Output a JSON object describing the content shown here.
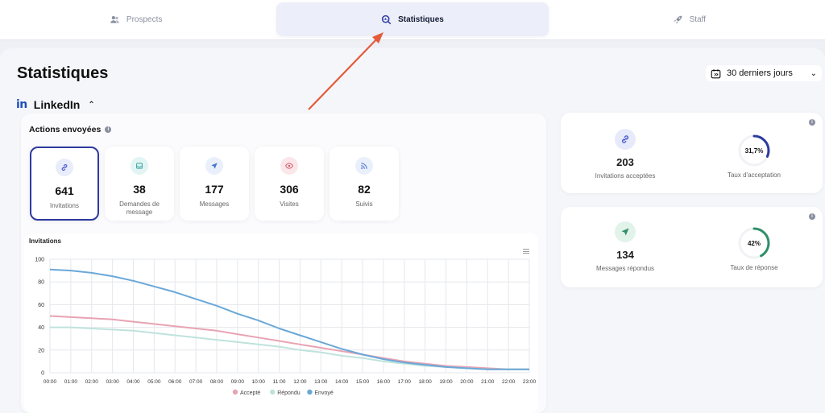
{
  "nav": {
    "tabs": [
      {
        "label": "Prospects",
        "icon": "users-icon",
        "active": false
      },
      {
        "label": "Statistiques",
        "icon": "chart-search-icon",
        "active": true
      },
      {
        "label": "Staff",
        "icon": "rocket-icon",
        "active": false
      }
    ]
  },
  "page": {
    "title": "Statistiques"
  },
  "period": {
    "label": "30 derniers jours",
    "icon": "calendar-icon"
  },
  "section": {
    "logo": "in",
    "title": "LinkedIn"
  },
  "actions": {
    "title": "Actions envoyées",
    "cards": [
      {
        "value": "641",
        "label": "Invitations",
        "icon": "link-icon",
        "color": "#4a5bd0",
        "bg": "#e9ecfb",
        "selected": true
      },
      {
        "value": "38",
        "label": "Demandes de message",
        "icon": "inbox-icon",
        "color": "#3aa5a0",
        "bg": "#e2f4f3",
        "selected": false
      },
      {
        "value": "177",
        "label": "Messages",
        "icon": "send-icon",
        "color": "#4a76d0",
        "bg": "#e9f0fb",
        "selected": false
      },
      {
        "value": "306",
        "label": "Visites",
        "icon": "eye-icon",
        "color": "#d05a6a",
        "bg": "#fbe6e9",
        "selected": false
      },
      {
        "value": "82",
        "label": "Suivis",
        "icon": "rss-icon",
        "color": "#4a76d0",
        "bg": "#e9f0fb",
        "selected": false
      }
    ]
  },
  "stats": [
    {
      "value": "203",
      "label": "Invitations acceptées",
      "icon": "link-icon",
      "icon_color": "#4a5bd0",
      "icon_bg": "#e7eafa",
      "gauge_label": "31,7%",
      "gauge_fraction": 0.317,
      "gauge_color": "#2d3a9e",
      "gauge_caption": "Taux d'acceptation"
    },
    {
      "value": "134",
      "label": "Messages répondus",
      "icon": "send-icon",
      "icon_color": "#2f8f6a",
      "icon_bg": "#e2f3ea",
      "gauge_label": "42%",
      "gauge_fraction": 0.42,
      "gauge_color": "#2f8f6a",
      "gauge_caption": "Taux de réponse"
    }
  ],
  "chart_data": {
    "type": "line",
    "title": "Invitations",
    "x": [
      "00:00",
      "01:00",
      "02:00",
      "03:00",
      "04:00",
      "05:00",
      "06:00",
      "07:00",
      "08:00",
      "09:00",
      "10:00",
      "11:00",
      "12:00",
      "13:00",
      "14:00",
      "15:00",
      "16:00",
      "17:00",
      "18:00",
      "19:00",
      "20:00",
      "21:00",
      "22:00",
      "23:00"
    ],
    "yticks": [
      0,
      20,
      40,
      60,
      80,
      100
    ],
    "ylim": [
      0,
      100
    ],
    "grid": true,
    "legend_position": "bottom",
    "series": [
      {
        "name": "Accepté",
        "color": "#e8a3b3",
        "values": [
          50,
          49,
          48,
          47,
          45,
          43,
          41,
          39,
          37,
          34,
          31,
          28,
          25,
          22,
          19,
          16,
          13,
          10,
          8,
          6,
          5,
          4,
          3,
          3
        ]
      },
      {
        "name": "Répondu",
        "color": "#bfe3dc",
        "values": [
          40,
          40,
          39,
          38,
          37,
          35,
          33,
          31,
          29,
          27,
          25,
          23,
          20,
          18,
          15,
          13,
          10,
          8,
          6,
          5,
          4,
          3,
          3,
          3
        ]
      },
      {
        "name": "Envoyé",
        "color": "#6aa8d8",
        "values": [
          91,
          90,
          88,
          85,
          81,
          76,
          71,
          65,
          59,
          52,
          46,
          39,
          33,
          27,
          21,
          16,
          12,
          9,
          7,
          5,
          4,
          3,
          3,
          3
        ]
      }
    ]
  }
}
